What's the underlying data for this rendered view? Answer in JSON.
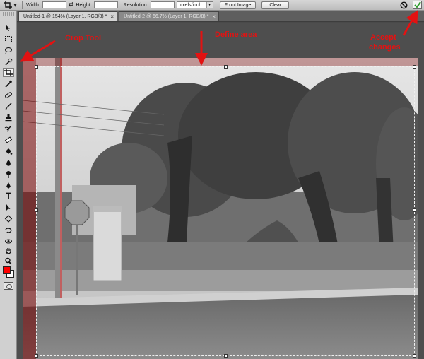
{
  "options_bar": {
    "tool_icon": "crop-icon",
    "width_label": "Width:",
    "width_value": "",
    "swap_icon": "swap-arrows-icon",
    "height_label": "Height:",
    "height_value": "",
    "resolution_label": "Resolution:",
    "resolution_value": "",
    "resolution_unit": "pixels/inch",
    "front_image_label": "Front Image",
    "clear_label": "Clear",
    "cancel_icon": "cancel-crop-icon",
    "commit_icon": "commit-check-icon"
  },
  "tabs": [
    {
      "label": "Untitled-1 @ 154% (Layer 1, RGB/8) *",
      "close": "×",
      "active": true
    },
    {
      "label": "Untitled-2 @ 66,7% (Layer 1, RGB/8) *",
      "close": "×",
      "active": false
    }
  ],
  "annotations": {
    "crop_tool": "Crop Tool",
    "define_area": "Define area",
    "accept_line1": "Accept",
    "accept_line2": "changes"
  },
  "colors": {
    "annotation": "#e31212",
    "foreground": "#ff0000",
    "background": "#ffffff",
    "commit_check": "#2a9d2a"
  }
}
